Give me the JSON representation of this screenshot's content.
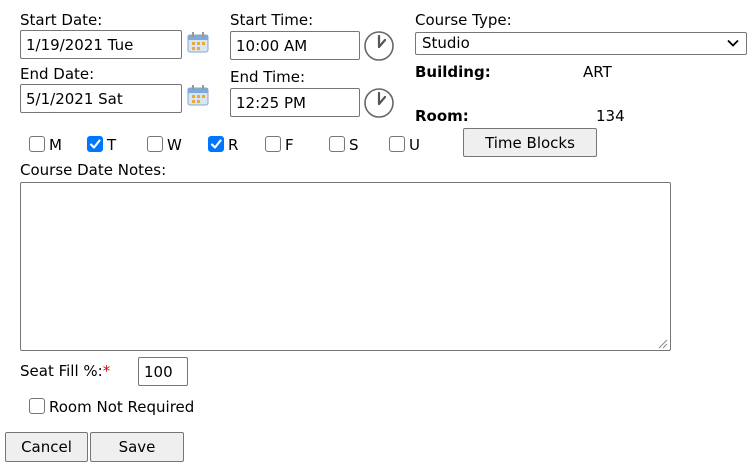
{
  "schedule": {
    "start_date_label": "Start Date:",
    "start_date_value": "1/19/2021 Tue",
    "end_date_label": "End Date:",
    "end_date_value": "5/1/2021 Sat",
    "start_time_label": "Start Time:",
    "start_time_value": "10:00 AM",
    "end_time_label": "End Time:",
    "end_time_value": "12:25 PM"
  },
  "course": {
    "type_label": "Course Type:",
    "type_selected": "Studio",
    "building_label": "Building:",
    "building_value": "ART",
    "room_label": "Room:",
    "room_value": "134"
  },
  "days": [
    {
      "label": "M",
      "checked": false
    },
    {
      "label": "T",
      "checked": true
    },
    {
      "label": "W",
      "checked": false
    },
    {
      "label": "R",
      "checked": true
    },
    {
      "label": "F",
      "checked": false
    },
    {
      "label": "S",
      "checked": false
    },
    {
      "label": "U",
      "checked": false
    }
  ],
  "time_blocks_label": "Time Blocks",
  "notes": {
    "label": "Course Date Notes:",
    "value": ""
  },
  "seat_fill": {
    "label": "Seat Fill %:",
    "required_mark": "*",
    "value": "100"
  },
  "room_not_required": {
    "label": "Room Not Required",
    "checked": false
  },
  "actions": {
    "cancel_label": "Cancel",
    "save_label": "Save"
  },
  "colors": {
    "checkbox_checked": "#0075ff",
    "required": "#e00000"
  },
  "icons": {
    "date_picker": "calendar-icon",
    "time_picker": "clock-icon",
    "select_arrow": "chevron-down-icon"
  }
}
